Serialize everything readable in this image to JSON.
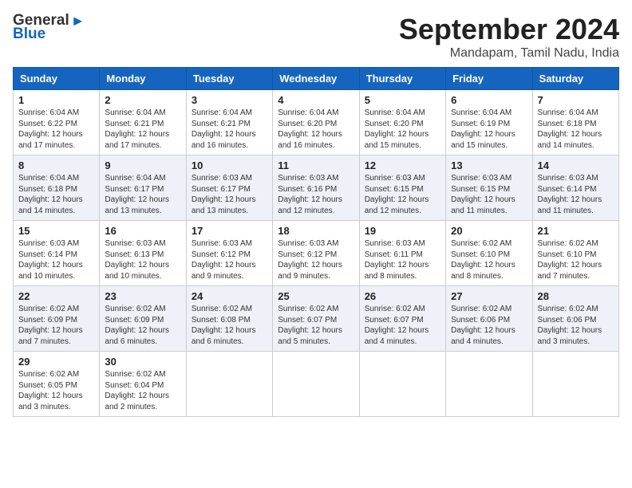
{
  "header": {
    "logo_general": "General",
    "logo_blue": "Blue",
    "month": "September 2024",
    "location": "Mandapam, Tamil Nadu, India"
  },
  "weekdays": [
    "Sunday",
    "Monday",
    "Tuesday",
    "Wednesday",
    "Thursday",
    "Friday",
    "Saturday"
  ],
  "weeks": [
    [
      {
        "day": "1",
        "sunrise": "6:04 AM",
        "sunset": "6:22 PM",
        "daylight": "12 hours and 17 minutes."
      },
      {
        "day": "2",
        "sunrise": "6:04 AM",
        "sunset": "6:21 PM",
        "daylight": "12 hours and 17 minutes."
      },
      {
        "day": "3",
        "sunrise": "6:04 AM",
        "sunset": "6:21 PM",
        "daylight": "12 hours and 16 minutes."
      },
      {
        "day": "4",
        "sunrise": "6:04 AM",
        "sunset": "6:20 PM",
        "daylight": "12 hours and 16 minutes."
      },
      {
        "day": "5",
        "sunrise": "6:04 AM",
        "sunset": "6:20 PM",
        "daylight": "12 hours and 15 minutes."
      },
      {
        "day": "6",
        "sunrise": "6:04 AM",
        "sunset": "6:19 PM",
        "daylight": "12 hours and 15 minutes."
      },
      {
        "day": "7",
        "sunrise": "6:04 AM",
        "sunset": "6:18 PM",
        "daylight": "12 hours and 14 minutes."
      }
    ],
    [
      {
        "day": "8",
        "sunrise": "6:04 AM",
        "sunset": "6:18 PM",
        "daylight": "12 hours and 14 minutes."
      },
      {
        "day": "9",
        "sunrise": "6:04 AM",
        "sunset": "6:17 PM",
        "daylight": "12 hours and 13 minutes."
      },
      {
        "day": "10",
        "sunrise": "6:03 AM",
        "sunset": "6:17 PM",
        "daylight": "12 hours and 13 minutes."
      },
      {
        "day": "11",
        "sunrise": "6:03 AM",
        "sunset": "6:16 PM",
        "daylight": "12 hours and 12 minutes."
      },
      {
        "day": "12",
        "sunrise": "6:03 AM",
        "sunset": "6:15 PM",
        "daylight": "12 hours and 12 minutes."
      },
      {
        "day": "13",
        "sunrise": "6:03 AM",
        "sunset": "6:15 PM",
        "daylight": "12 hours and 11 minutes."
      },
      {
        "day": "14",
        "sunrise": "6:03 AM",
        "sunset": "6:14 PM",
        "daylight": "12 hours and 11 minutes."
      }
    ],
    [
      {
        "day": "15",
        "sunrise": "6:03 AM",
        "sunset": "6:14 PM",
        "daylight": "12 hours and 10 minutes."
      },
      {
        "day": "16",
        "sunrise": "6:03 AM",
        "sunset": "6:13 PM",
        "daylight": "12 hours and 10 minutes."
      },
      {
        "day": "17",
        "sunrise": "6:03 AM",
        "sunset": "6:12 PM",
        "daylight": "12 hours and 9 minutes."
      },
      {
        "day": "18",
        "sunrise": "6:03 AM",
        "sunset": "6:12 PM",
        "daylight": "12 hours and 9 minutes."
      },
      {
        "day": "19",
        "sunrise": "6:03 AM",
        "sunset": "6:11 PM",
        "daylight": "12 hours and 8 minutes."
      },
      {
        "day": "20",
        "sunrise": "6:02 AM",
        "sunset": "6:10 PM",
        "daylight": "12 hours and 8 minutes."
      },
      {
        "day": "21",
        "sunrise": "6:02 AM",
        "sunset": "6:10 PM",
        "daylight": "12 hours and 7 minutes."
      }
    ],
    [
      {
        "day": "22",
        "sunrise": "6:02 AM",
        "sunset": "6:09 PM",
        "daylight": "12 hours and 7 minutes."
      },
      {
        "day": "23",
        "sunrise": "6:02 AM",
        "sunset": "6:09 PM",
        "daylight": "12 hours and 6 minutes."
      },
      {
        "day": "24",
        "sunrise": "6:02 AM",
        "sunset": "6:08 PM",
        "daylight": "12 hours and 6 minutes."
      },
      {
        "day": "25",
        "sunrise": "6:02 AM",
        "sunset": "6:07 PM",
        "daylight": "12 hours and 5 minutes."
      },
      {
        "day": "26",
        "sunrise": "6:02 AM",
        "sunset": "6:07 PM",
        "daylight": "12 hours and 4 minutes."
      },
      {
        "day": "27",
        "sunrise": "6:02 AM",
        "sunset": "6:06 PM",
        "daylight": "12 hours and 4 minutes."
      },
      {
        "day": "28",
        "sunrise": "6:02 AM",
        "sunset": "6:06 PM",
        "daylight": "12 hours and 3 minutes."
      }
    ],
    [
      {
        "day": "29",
        "sunrise": "6:02 AM",
        "sunset": "6:05 PM",
        "daylight": "12 hours and 3 minutes."
      },
      {
        "day": "30",
        "sunrise": "6:02 AM",
        "sunset": "6:04 PM",
        "daylight": "12 hours and 2 minutes."
      },
      null,
      null,
      null,
      null,
      null
    ]
  ]
}
